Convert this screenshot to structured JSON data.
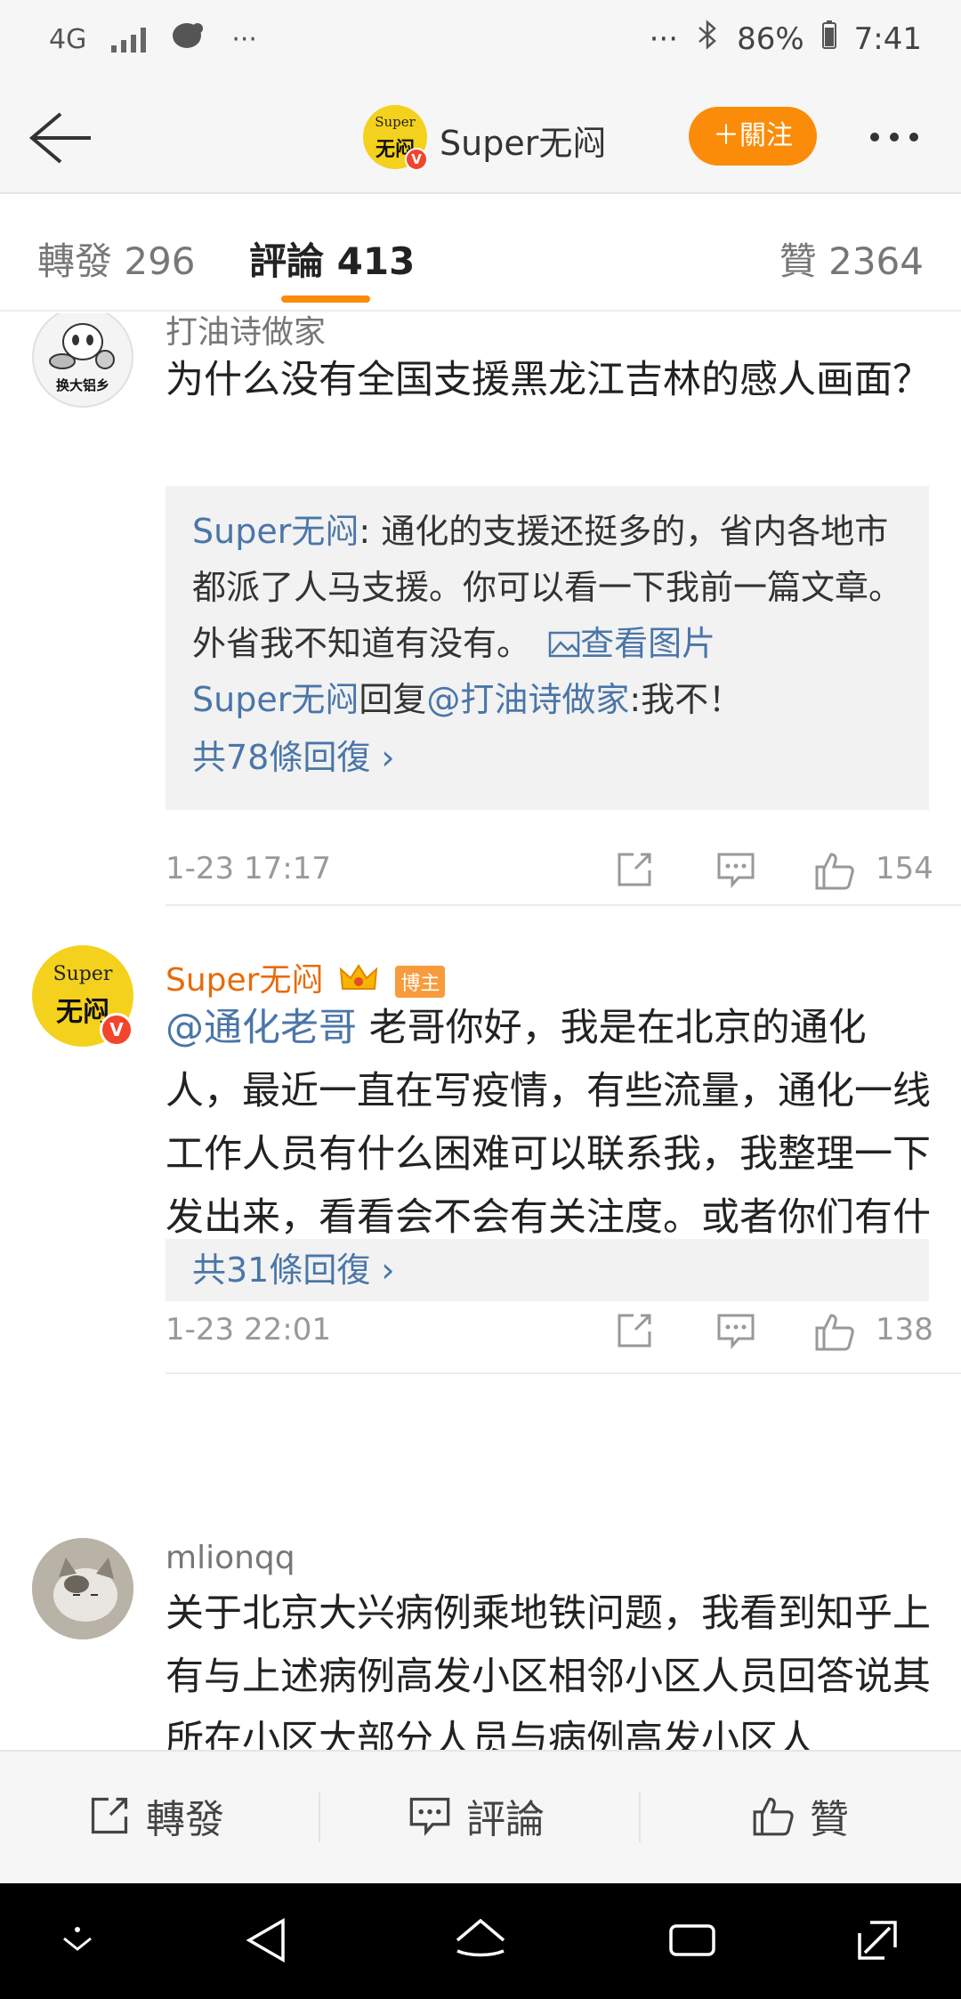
{
  "status": {
    "network": "4G",
    "left_more": "···",
    "right_more": "···",
    "battery": "86%",
    "time": "7:41"
  },
  "header": {
    "avatar_text_top": "Super",
    "avatar_text_main": "无闷",
    "verified": "V",
    "user_name": "Super无闷",
    "follow_label": "＋關注"
  },
  "tabs": {
    "repost": "轉發 296",
    "comments": "評論 413",
    "likes": "贊 2364"
  },
  "comments": [
    {
      "user": "打油诗做家",
      "avatar_caption": "换大铝乡",
      "text": "为什么没有全国支援黑龙江吉林的感人画面？",
      "reply1_author": "Super无闷",
      "reply1_text": ": 通化的支援还挺多的，省内各地市都派了人马支援。你可以看一下我前一篇文章。外省我不知道有没有。",
      "reply1_image_link": "查看图片",
      "reply2_author": "Super无闷",
      "reply2_mid": "回复",
      "reply2_target": "@打油诗做家",
      "reply2_text": ":我不！",
      "replies_link": "共78條回復 ›",
      "time": "1-23 17:17",
      "likes": "154"
    },
    {
      "user": "Super无闷",
      "avatar_text_top": "Super",
      "avatar_text_main": "无闷",
      "verified": "V",
      "owner_badge": "博主",
      "mention": "@通化老哥",
      "text": " 老哥你好，我是在北京的通化人，最近一直在写疫情，有些流量，通化一线工作人员有什么困难可以联系我，我整理一下发出来，看看会不会有关注度。或者你们有什么群也可以拉我进去。",
      "replies_link": "共31條回復 ›",
      "time": "1-23 22:01",
      "likes": "138"
    },
    {
      "user": "mlionqq",
      "text": "关于北京大兴病例乘地铁问题，我看到知乎上有与上述病例高发小区相邻小区人员回答说其所在小区大部分人员与病例高发小区人"
    }
  ],
  "bottom_bar": {
    "repost": "轉發",
    "comment": "評論",
    "like": "贊"
  },
  "colors": {
    "accent": "#fb8c0a",
    "link_blue": "#4a76a8",
    "owner_orange": "#e86b0c"
  }
}
